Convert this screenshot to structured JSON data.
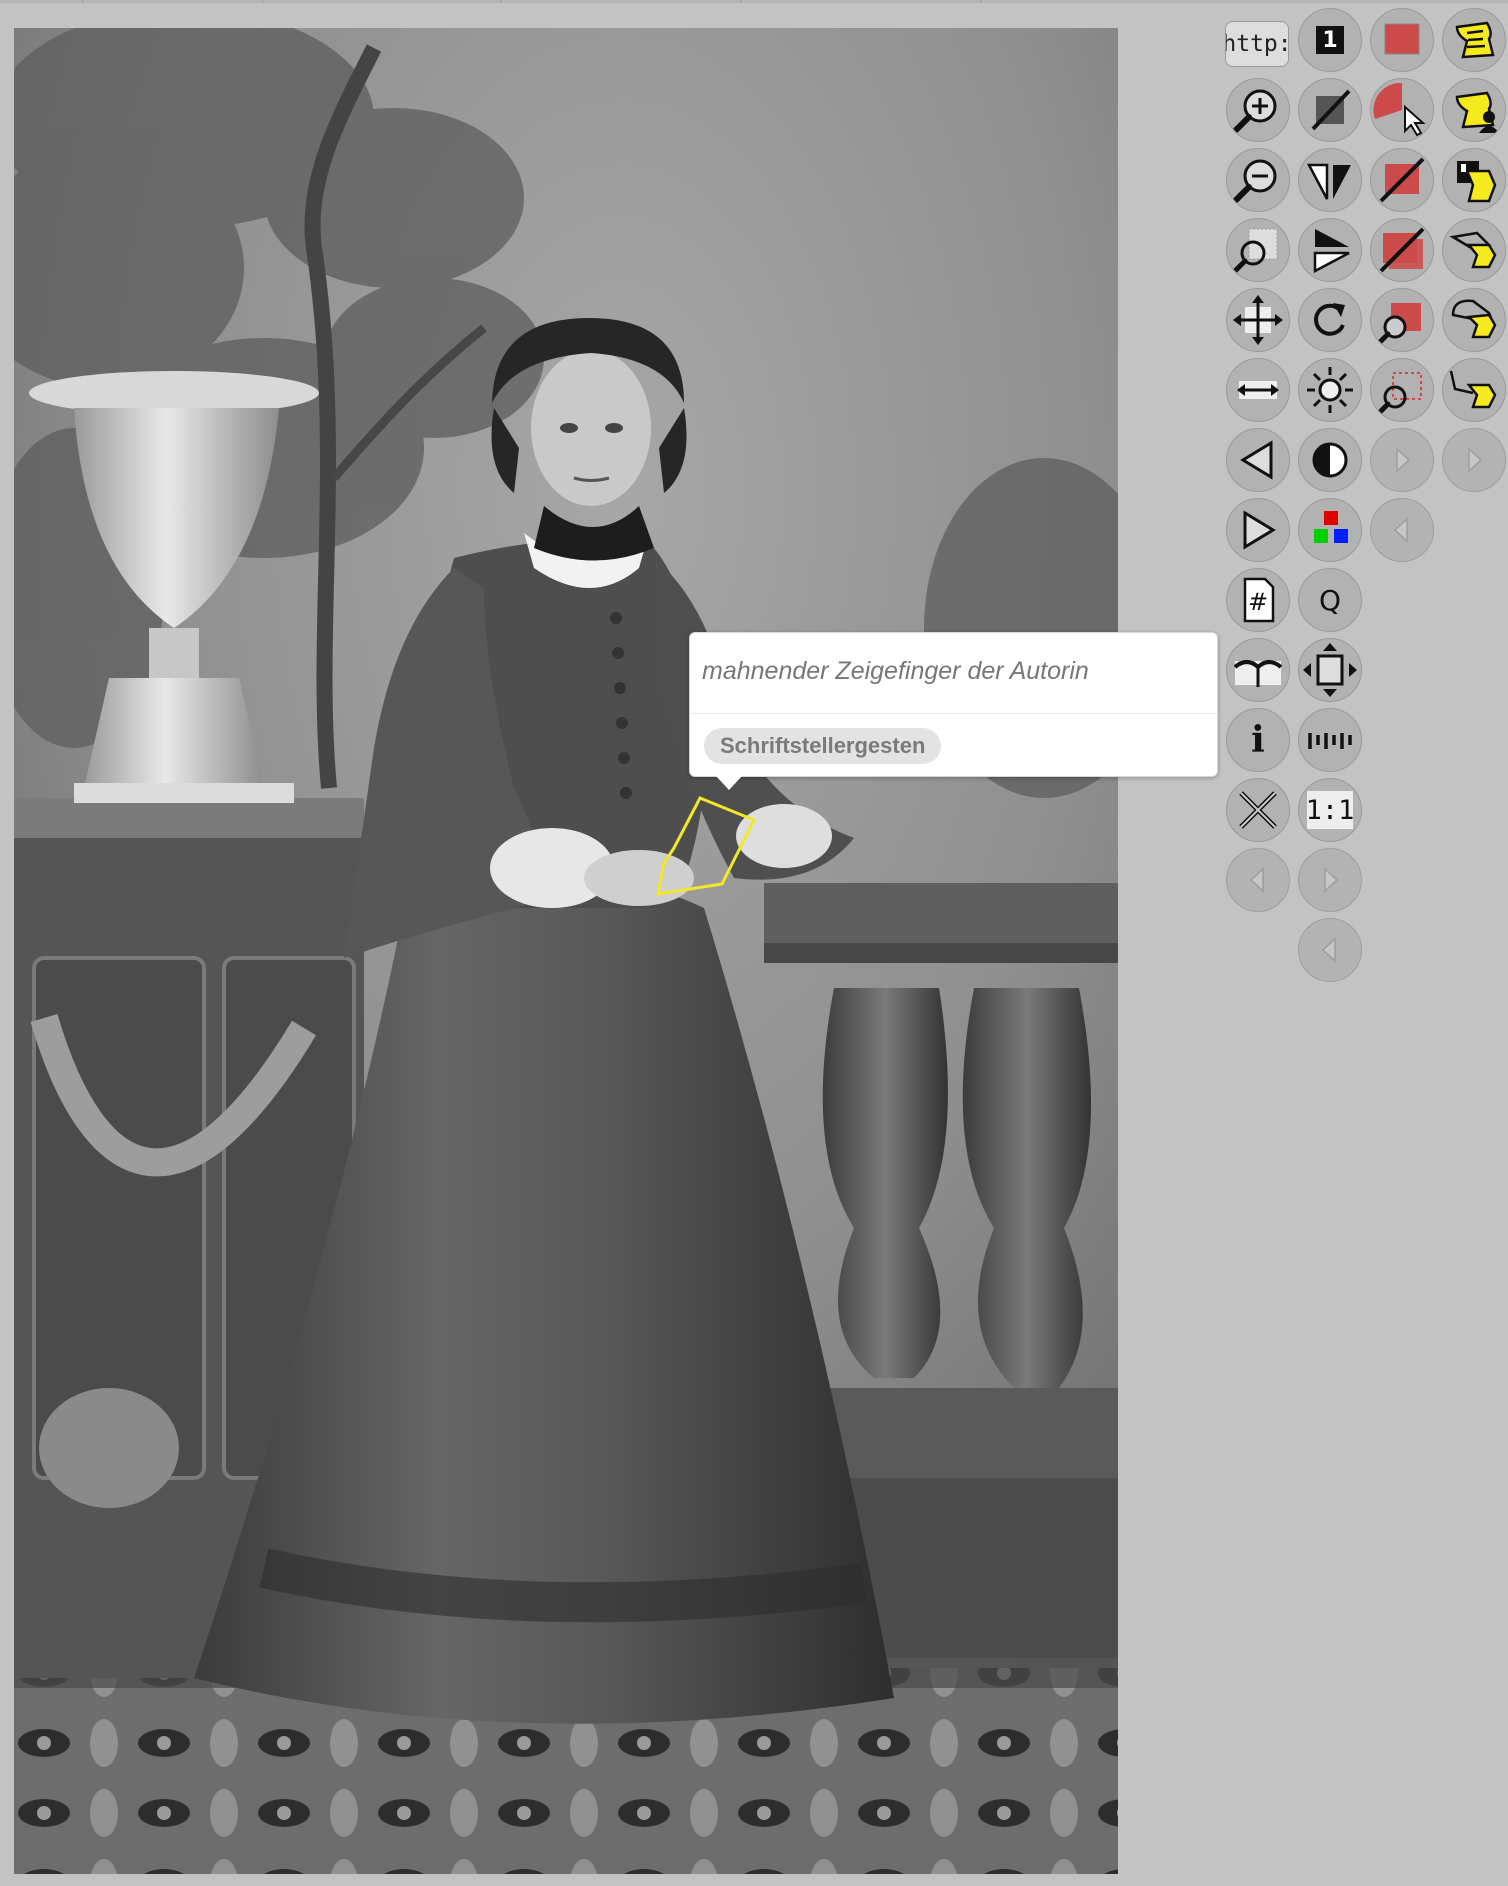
{
  "annotation": {
    "note": "mahnender Zeigefinger der Autorin",
    "tag": "Schriftstellergesten",
    "highlight_color": "#f2e82a"
  },
  "toolbar": {
    "http_label": "http:",
    "page_label": "1",
    "query_label": "Q",
    "hash_label": "#",
    "info_label": "i",
    "original_size_label": "1:1"
  },
  "colors": {
    "background": "#c3c3c3",
    "button": "#b2b2b2",
    "accent_red": "#cc4a4a",
    "accent_yellow": "#f5ea1e"
  }
}
